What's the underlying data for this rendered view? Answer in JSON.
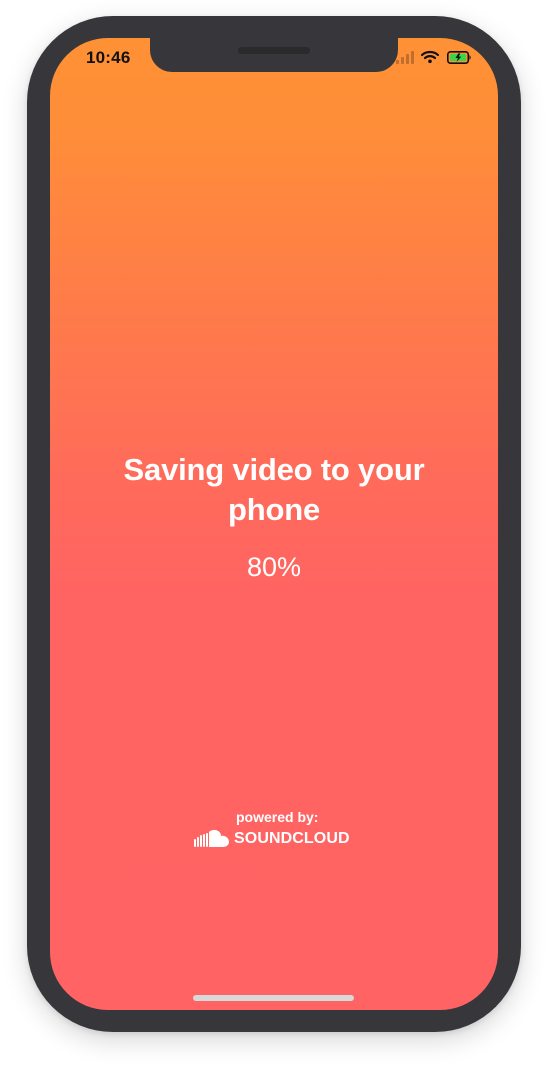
{
  "status_bar": {
    "time": "10:46",
    "icons": [
      "signal-icon",
      "wifi-icon",
      "battery-icon"
    ],
    "battery_state": "charging"
  },
  "main": {
    "title": "Saving video to your phone",
    "progress_text": "80%",
    "progress_value": 80
  },
  "footer": {
    "powered_by": "powered by:",
    "brand": "SOUNDCLOUD",
    "brand_icon": "soundcloud-cloud-icon"
  },
  "colors": {
    "gradient_top": "#ff9135",
    "gradient_bottom": "#ff6363",
    "frame": "#37373b",
    "text": "#ffffff"
  }
}
